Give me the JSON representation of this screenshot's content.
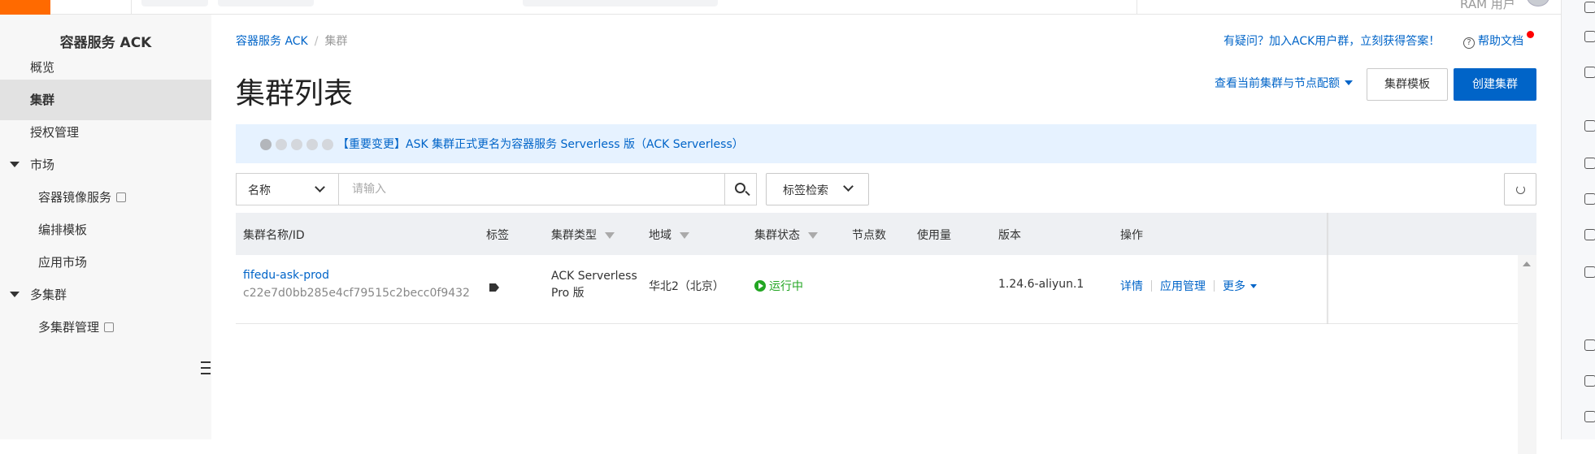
{
  "topbar": {
    "ram_label": "RAM 用户"
  },
  "sidebar": {
    "title": "容器服务 ACK",
    "items": [
      {
        "label": "概览"
      },
      {
        "label": "集群"
      },
      {
        "label": "授权管理"
      },
      {
        "label": "市场"
      },
      {
        "label": "容器镜像服务"
      },
      {
        "label": "编排模板"
      },
      {
        "label": "应用市场"
      },
      {
        "label": "多集群"
      },
      {
        "label": "多集群管理"
      }
    ]
  },
  "breadcrumb": {
    "root": "容器服务 ACK",
    "separator": "/",
    "current": "集群"
  },
  "header": {
    "help_text": "有疑问？加入ACK用户群，立刻获得答案！",
    "help_doc": "帮助文档",
    "title": "集群列表",
    "view_config": "查看当前集群与节点配额",
    "template_button": "集群模板",
    "create_button": "创建集群"
  },
  "notice": {
    "text": "【重要变更】ASK 集群正式更名为容器服务 Serverless 版（ACK Serverless）"
  },
  "search": {
    "field_label": "名称",
    "placeholder": "请输入",
    "tag_search": "标签检索"
  },
  "table": {
    "columns": {
      "name": "集群名称/ID",
      "tags": "标签",
      "type": "集群类型",
      "region": "地域",
      "status": "集群状态",
      "nodes": "节点数",
      "usage": "使用量",
      "version": "版本",
      "ops": "操作"
    },
    "rows": [
      {
        "name": "fifedu-ask-prod",
        "id": "c22e7d0bb285e4cf79515c2becc0f9432",
        "type": "ACK Serverless Pro 版",
        "region": "华北2（北京）",
        "status": "运行中",
        "version": "1.24.6-aliyun.1",
        "ops": {
          "detail": "详情",
          "apps": "应用管理",
          "more": "更多"
        }
      }
    ]
  },
  "colors": {
    "accent": "#0064c8",
    "brand": "#ff6a00",
    "running": "#23a623"
  }
}
